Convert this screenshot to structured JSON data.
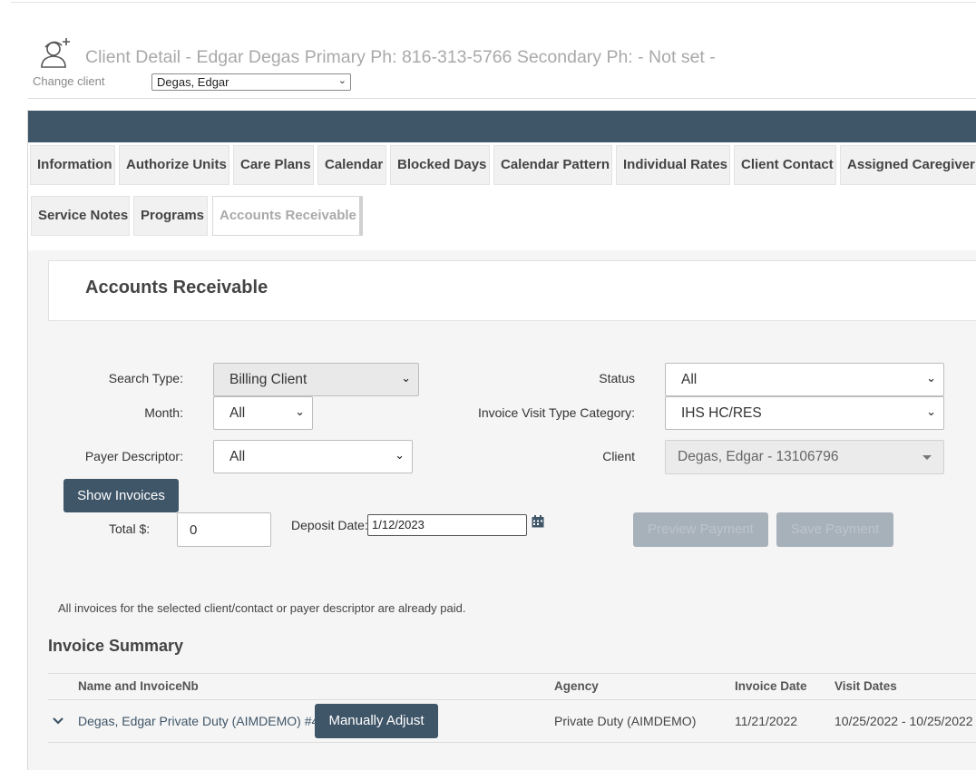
{
  "header": {
    "title": "Client Detail - Edgar Degas Primary Ph: 816-313-5766 Secondary Ph: - Not set -",
    "icon": "add-user-icon",
    "change_client_label": "Change client",
    "change_client_value": "Degas, Edgar"
  },
  "tabs": [
    {
      "label": "Information"
    },
    {
      "label": "Authorize Units"
    },
    {
      "label": "Care Plans"
    },
    {
      "label": "Calendar"
    },
    {
      "label": "Blocked Days"
    },
    {
      "label": "Calendar Pattern"
    },
    {
      "label": "Individual Rates"
    },
    {
      "label": "Client Contact"
    },
    {
      "label": "Assigned Caregiver"
    },
    {
      "label": "Service Notes"
    },
    {
      "label": "Programs"
    },
    {
      "label": "Accounts Receivable"
    }
  ],
  "active_tab": "Accounts Receivable",
  "section_title": "Accounts Receivable",
  "filters": {
    "search_type_label": "Search Type:",
    "search_type_value": "Billing Client",
    "month_label": "Month:",
    "month_value": "All",
    "payer_descriptor_label": "Payer Descriptor:",
    "payer_descriptor_value": "All",
    "status_label": "Status",
    "status_value": "All",
    "visit_type_label": "Invoice Visit Type Category:",
    "visit_type_value": "IHS HC/RES",
    "client_label": "Client",
    "client_value": "Degas, Edgar - 13106796"
  },
  "actions": {
    "show_invoices": "Show Invoices",
    "total_label": "Total $:",
    "total_value": "0",
    "deposit_label": "Deposit Date:",
    "deposit_value": "1/12/2023",
    "preview_payment": "Preview Payment",
    "save_payment": "Save Payment"
  },
  "message": "All invoices for the selected client/contact or payer descriptor are already paid.",
  "invoice_summary": {
    "title": "Invoice Summary",
    "columns": [
      "Name and InvoiceNb",
      "Agency",
      "Invoice Date",
      "Visit Dates"
    ],
    "rows": [
      {
        "name": "Degas, Edgar Private Duty (AIMDEMO) #45",
        "adjust_label": "Manually Adjust",
        "agency": "Private Duty (AIMDEMO)",
        "invoice_date": "11/21/2022",
        "visit_dates": "10/25/2022 - 10/25/2022"
      }
    ]
  },
  "colors": {
    "accent": "#3f5568",
    "panel_bg": "#f5f5f5",
    "disabled_button": "#a7b1ba"
  }
}
